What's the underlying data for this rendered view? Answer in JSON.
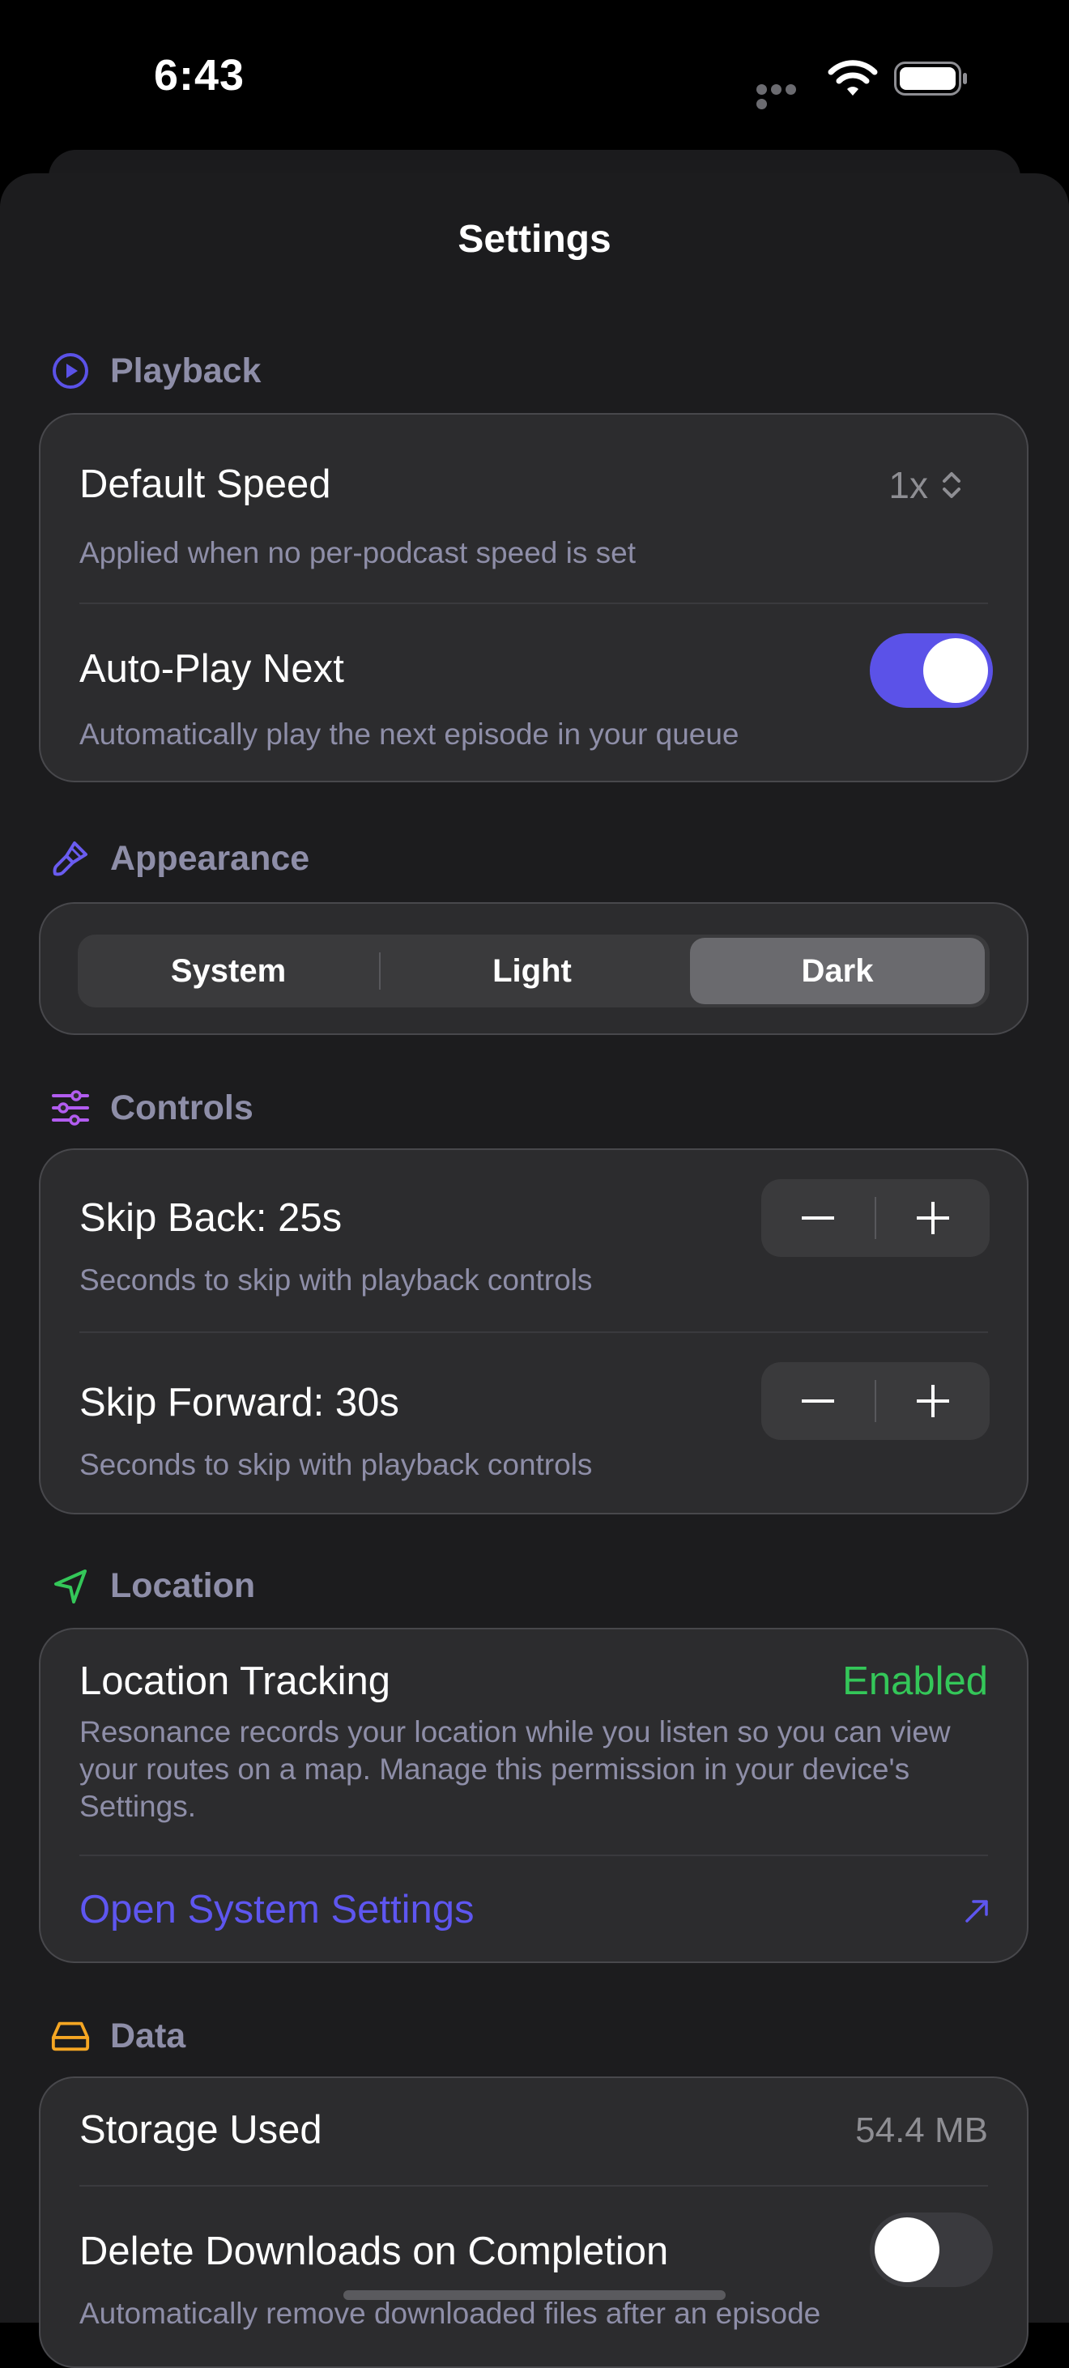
{
  "status": {
    "time": "6:43"
  },
  "sheet": {
    "title": "Settings"
  },
  "playback": {
    "header": "Playback",
    "default_speed_label": "Default Speed",
    "default_speed_value": "1x",
    "default_speed_sub": "Applied when no per-podcast speed is set",
    "autoplay_label": "Auto-Play Next",
    "autoplay_sub": "Automatically play the next episode in your queue",
    "autoplay_on": true
  },
  "appearance": {
    "header": "Appearance",
    "options": [
      "System",
      "Light",
      "Dark"
    ],
    "selected": "Dark"
  },
  "controls": {
    "header": "Controls",
    "skip_back_label": "Skip Back: 25s",
    "skip_back_sub": "Seconds to skip with playback controls",
    "skip_forward_label": "Skip Forward: 30s",
    "skip_forward_sub": "Seconds to skip with playback controls"
  },
  "location": {
    "header": "Location",
    "tracking_label": "Location Tracking",
    "tracking_status": "Enabled",
    "description": "Resonance records your location while you listen so you can view your routes on a map. Manage this permission in your device's Settings.",
    "open_settings_label": "Open System Settings"
  },
  "data": {
    "header": "Data",
    "storage_label": "Storage Used",
    "storage_value": "54.4 MB",
    "delete_label": "Delete Downloads on Completion",
    "delete_sub": "Automatically remove downloaded files after an episode",
    "delete_on": false
  },
  "colors": {
    "accent": "#5b52e8",
    "playback_icon": "#5b52e8",
    "appearance_icon": "#6a5cf0",
    "controls_icon": "#b25cf0",
    "location_icon": "#34c759",
    "data_icon": "#f5a623",
    "enabled_text": "#34c759"
  }
}
